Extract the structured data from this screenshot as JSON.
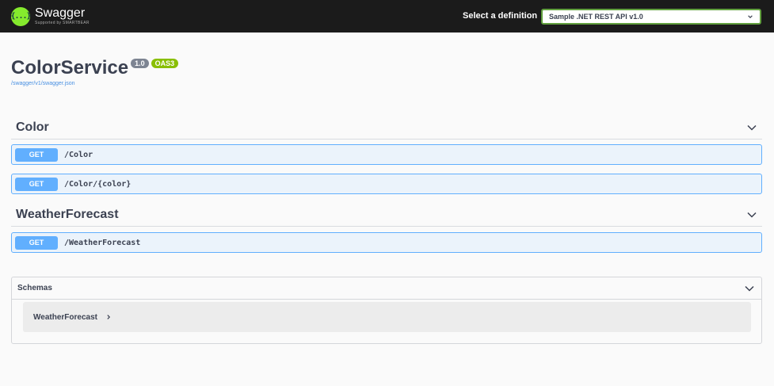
{
  "topbar": {
    "logo_symbol": "{...}",
    "brand": "Swagger",
    "brand_sub": "Supported by SMARTBEAR",
    "definition_label": "Select a definition",
    "definition_selected": "Sample .NET REST API v1.0"
  },
  "info": {
    "title": "ColorService",
    "version": "1.0",
    "oas": "OAS3",
    "spec_url": "/swagger/v1/swagger.json"
  },
  "tags": [
    {
      "name": "Color",
      "operations": [
        {
          "method": "GET",
          "path": "/Color"
        },
        {
          "method": "GET",
          "path": "/Color/{color}"
        }
      ]
    },
    {
      "name": "WeatherForecast",
      "operations": [
        {
          "method": "GET",
          "path": "/WeatherForecast"
        }
      ]
    }
  ],
  "schemas": {
    "title": "Schemas",
    "models": [
      {
        "name": "WeatherForecast"
      }
    ]
  },
  "colors": {
    "topbar_bg": "#1b1b1b",
    "logo_green": "#85ea2d",
    "get_blue": "#61affe",
    "get_bg": "#ebf3fb",
    "select_border": "#62a03f"
  },
  "icons": {
    "logo": "swagger-logo-icon",
    "select_chevron": "chevron-down-icon",
    "tag_chevron": "chevron-down-icon",
    "model_arrow": "chevron-right-icon"
  }
}
